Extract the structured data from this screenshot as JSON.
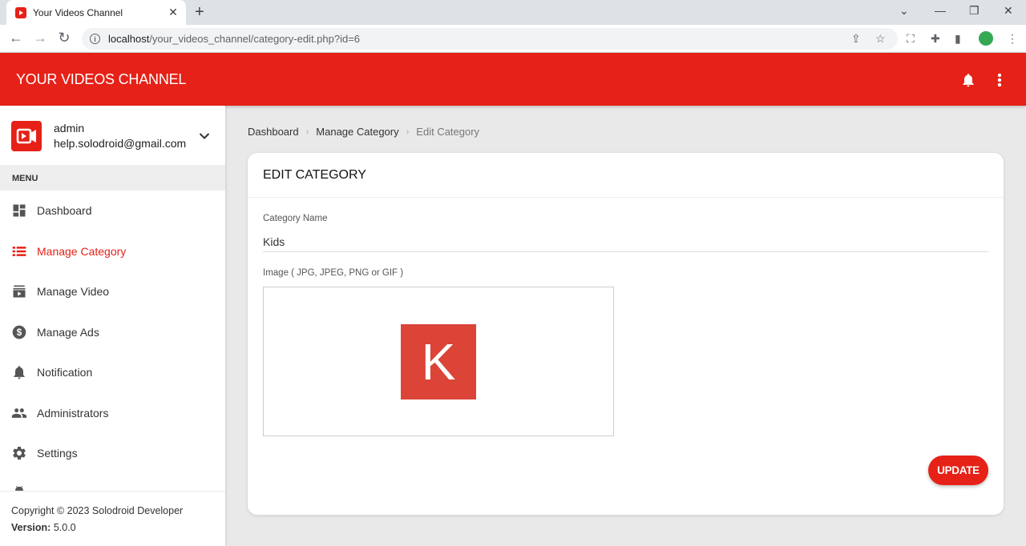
{
  "browser": {
    "tab_title": "Your Videos Channel",
    "url_host": "localhost",
    "url_path": "/your_videos_channel/category-edit.php?id=6"
  },
  "app": {
    "brand": "YOUR VIDEOS CHANNEL",
    "brand_color": "#e62117"
  },
  "user": {
    "name": "admin",
    "email": "help.solodroid@gmail.com"
  },
  "sidebar": {
    "menu_header": "MENU",
    "items": [
      {
        "label": "Dashboard",
        "icon": "dashboard-icon"
      },
      {
        "label": "Manage Category",
        "icon": "category-list-icon",
        "active": true
      },
      {
        "label": "Manage Video",
        "icon": "video-icon"
      },
      {
        "label": "Manage Ads",
        "icon": "dollar-icon"
      },
      {
        "label": "Notification",
        "icon": "bell-icon"
      },
      {
        "label": "Administrators",
        "icon": "people-icon"
      },
      {
        "label": "Settings",
        "icon": "gear-icon"
      }
    ],
    "copyright": "Copyright © 2023 Solodroid Developer",
    "version_label": "Version:",
    "version_value": "5.0.0"
  },
  "breadcrumb": [
    "Dashboard",
    "Manage Category",
    "Edit Category"
  ],
  "form": {
    "title": "EDIT CATEGORY",
    "name_label": "Category Name",
    "name_value": "Kids",
    "image_label": "Image ( JPG, JPEG, PNG or GIF )",
    "image_letter": "K",
    "image_color": "#db4437",
    "submit_label": "UPDATE"
  }
}
